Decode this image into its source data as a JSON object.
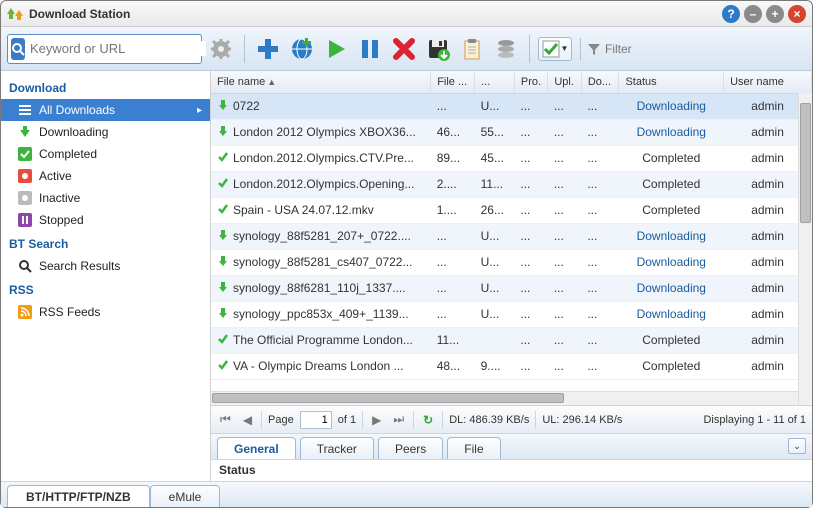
{
  "window": {
    "title": "Download Station"
  },
  "search": {
    "placeholder": "Keyword or URL"
  },
  "filter": {
    "placeholder": "Filter"
  },
  "sidebar": {
    "sections": [
      {
        "header": "Download",
        "items": [
          {
            "icon": "list-icon",
            "label": "All Downloads",
            "selected": true
          },
          {
            "icon": "down-arrow-icon",
            "label": "Downloading"
          },
          {
            "icon": "check-icon",
            "label": "Completed"
          },
          {
            "icon": "active-icon",
            "label": "Active"
          },
          {
            "icon": "inactive-icon",
            "label": "Inactive"
          },
          {
            "icon": "pause-icon",
            "label": "Stopped"
          }
        ]
      },
      {
        "header": "BT Search",
        "items": [
          {
            "icon": "search-icon",
            "label": "Search Results"
          }
        ]
      },
      {
        "header": "RSS",
        "items": [
          {
            "icon": "rss-icon",
            "label": "RSS Feeds"
          }
        ]
      }
    ]
  },
  "columns": [
    "File name",
    "File ...",
    "...",
    "Pro.",
    "Upl.",
    "Do...",
    "Status",
    "User name"
  ],
  "rows": [
    {
      "icon": "dl",
      "name": "0722",
      "file": "...",
      "c2": "U...",
      "c3": "...",
      "c4": "...",
      "c5": "...",
      "status": "Downloading",
      "user": "admin",
      "sel": true
    },
    {
      "icon": "dl",
      "name": "London 2012 Olympics XBOX36...",
      "file": "46...",
      "c2": "55...",
      "c3": "...",
      "c4": "...",
      "c5": "...",
      "status": "Downloading",
      "user": "admin"
    },
    {
      "icon": "cp",
      "name": "London.2012.Olympics.CTV.Pre...",
      "file": "89...",
      "c2": "45...",
      "c3": "...",
      "c4": "...",
      "c5": "...",
      "status": "Completed",
      "user": "admin"
    },
    {
      "icon": "cp",
      "name": "London.2012.Olympics.Opening...",
      "file": "2....",
      "c2": "11...",
      "c3": "...",
      "c4": "...",
      "c5": "...",
      "status": "Completed",
      "user": "admin"
    },
    {
      "icon": "cp",
      "name": "Spain - USA 24.07.12.mkv",
      "file": "1....",
      "c2": "26...",
      "c3": "...",
      "c4": "...",
      "c5": "...",
      "status": "Completed",
      "user": "admin"
    },
    {
      "icon": "dl",
      "name": "synology_88f5281_207+_0722....",
      "file": "...",
      "c2": "U...",
      "c3": "...",
      "c4": "...",
      "c5": "...",
      "status": "Downloading",
      "user": "admin"
    },
    {
      "icon": "dl",
      "name": "synology_88f5281_cs407_0722...",
      "file": "...",
      "c2": "U...",
      "c3": "...",
      "c4": "...",
      "c5": "...",
      "status": "Downloading",
      "user": "admin"
    },
    {
      "icon": "dl",
      "name": "synology_88f6281_110j_1337....",
      "file": "...",
      "c2": "U...",
      "c3": "...",
      "c4": "...",
      "c5": "...",
      "status": "Downloading",
      "user": "admin"
    },
    {
      "icon": "dl",
      "name": "synology_ppc853x_409+_1139...",
      "file": "...",
      "c2": "U...",
      "c3": "...",
      "c4": "...",
      "c5": "...",
      "status": "Downloading",
      "user": "admin"
    },
    {
      "icon": "cp",
      "name": "The Official Programme London...",
      "file": "11...",
      "c2": "",
      "c3": "...",
      "c4": "...",
      "c5": "...",
      "status": "Completed",
      "user": "admin"
    },
    {
      "icon": "cp",
      "name": "VA - Olympic Dreams London ...",
      "file": "48...",
      "c2": "9....",
      "c3": "...",
      "c4": "...",
      "c5": "...",
      "status": "Completed",
      "user": "admin"
    }
  ],
  "pager": {
    "page_label": "Page",
    "page": "1",
    "of": "of 1",
    "dl": "DL: 486.39 KB/s",
    "ul": "UL: 296.14 KB/s",
    "display": "Displaying 1 - 11 of 1"
  },
  "detail_tabs": [
    "General",
    "Tracker",
    "Peers",
    "File"
  ],
  "status_panel": {
    "label": "Status"
  },
  "bottom_tabs": [
    "BT/HTTP/FTP/NZB",
    "eMule"
  ]
}
